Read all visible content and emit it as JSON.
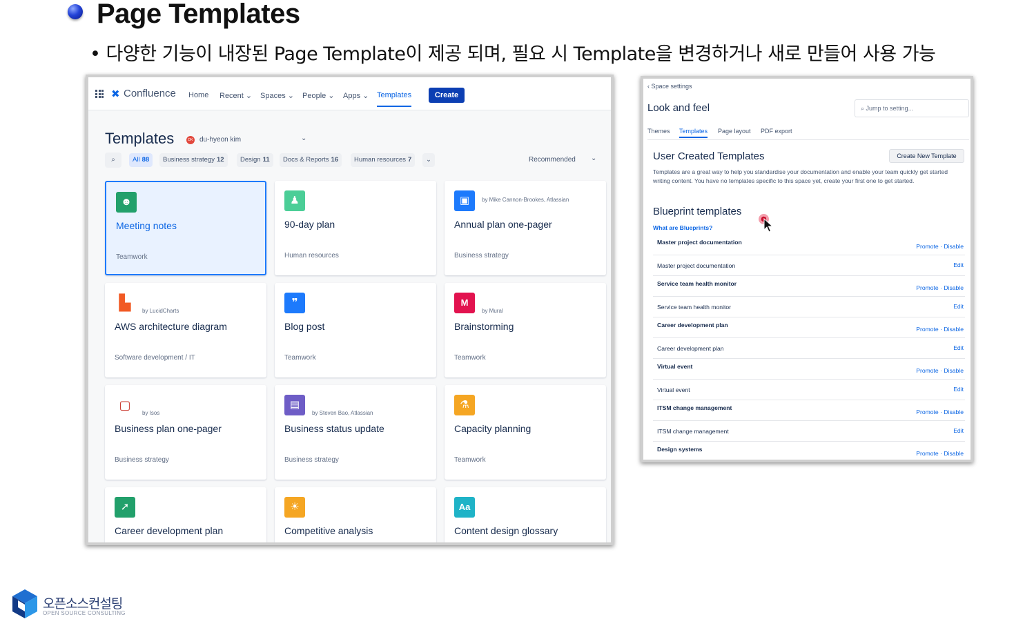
{
  "slide": {
    "title": "Page Templates",
    "subtitle": "• 다양한 기능이 내장된 Page Template이 제공 되며, 필요 시 Template을 변경하거나 새로 만들어 사용 가능"
  },
  "confluence": {
    "nav": {
      "logo": "Confluence",
      "items": [
        "Home",
        "Recent ⌄",
        "Spaces ⌄",
        "People ⌄",
        "Apps ⌄"
      ],
      "active_item": "Templates",
      "create_label": "Create"
    },
    "heading": "Templates",
    "user": {
      "initials": "DK",
      "name": "du-hyeon kim"
    },
    "filters": [
      {
        "label": "All",
        "count": "88"
      },
      {
        "label": "Business strategy",
        "count": "12"
      },
      {
        "label": "Design",
        "count": "11"
      },
      {
        "label": "Docs & Reports",
        "count": "16"
      },
      {
        "label": "Human resources",
        "count": "7"
      }
    ],
    "sort_label": "Recommended",
    "cards": [
      {
        "title": "Meeting notes",
        "category": "Teamwork",
        "by": "",
        "icon": "people-icon",
        "color": "#22a06b"
      },
      {
        "title": "90-day plan",
        "category": "Human resources",
        "by": "",
        "icon": "person-plan-icon",
        "color": "#4bce97"
      },
      {
        "title": "Annual plan one-pager",
        "category": "Business strategy",
        "by": "by Mike Cannon-Brookes, Atlassian",
        "icon": "calendar-icon",
        "color": "#1d7afc"
      },
      {
        "title": "AWS architecture diagram",
        "category": "Software development / IT",
        "by": "by LucidCharts",
        "icon": "lucid-icon",
        "color": "#f15a24"
      },
      {
        "title": "Blog post",
        "category": "Teamwork",
        "by": "",
        "icon": "quote-icon",
        "color": "#1d7afc"
      },
      {
        "title": "Brainstorming",
        "category": "Teamwork",
        "by": "by Mural",
        "icon": "mural-icon",
        "color": "#e2134f"
      },
      {
        "title": "Business plan one-pager",
        "category": "Business strategy",
        "by": "by Isos",
        "icon": "isos-icon",
        "color": "#c9372c"
      },
      {
        "title": "Business status update",
        "category": "Business strategy",
        "by": "by Steven Bao, Atlassian",
        "icon": "report-icon",
        "color": "#6e5dc6"
      },
      {
        "title": "Capacity planning",
        "category": "Teamwork",
        "by": "",
        "icon": "beaker-icon",
        "color": "#f5a623"
      },
      {
        "title": "Career development plan",
        "category": "",
        "by": "",
        "icon": "arrow-up-icon",
        "color": "#22a06b"
      },
      {
        "title": "Competitive analysis",
        "category": "",
        "by": "",
        "icon": "lightbulb-icon",
        "color": "#f5a623"
      },
      {
        "title": "Content design glossary",
        "category": "",
        "by": "",
        "icon": "text-aa-icon",
        "color": "#1fb3c7"
      }
    ]
  },
  "space_settings": {
    "back_label": "Space settings",
    "title": "Look and feel",
    "search_placeholder": "Jump to setting...",
    "tabs": [
      "Themes",
      "Templates",
      "Page layout",
      "PDF export"
    ],
    "active_tab": "Templates",
    "user_created_title": "User Created Templates",
    "create_button": "Create New Template",
    "description": "Templates are a great way to help you standardise your documentation and enable your team quickly get started writing content. You have no templates specific to this space yet, create your first one to get started.",
    "blueprint_title": "Blueprint templates",
    "blueprint_link": "What are Blueprints?",
    "blueprints": [
      {
        "name": "Master project documentation",
        "actions": "Promote · Disable",
        "sub_name": "Master project documentation",
        "sub_action": "Edit"
      },
      {
        "name": "Service team health monitor",
        "actions": "Promote · Disable",
        "sub_name": "Service team health monitor",
        "sub_action": "Edit"
      },
      {
        "name": "Career development plan",
        "actions": "Promote · Disable",
        "sub_name": "Career development plan",
        "sub_action": "Edit"
      },
      {
        "name": "Virtual event",
        "actions": "Promote · Disable",
        "sub_name": "Virtual event",
        "sub_action": "Edit"
      },
      {
        "name": "ITSM change management",
        "actions": "Promote · Disable",
        "sub_name": "ITSM change management",
        "sub_action": "Edit"
      },
      {
        "name": "Design systems",
        "actions": "Promote · Disable"
      }
    ]
  },
  "footer": {
    "logo_korean": "오픈소스컨설팅",
    "logo_english": "OPEN SOURCE CONSULTING"
  }
}
